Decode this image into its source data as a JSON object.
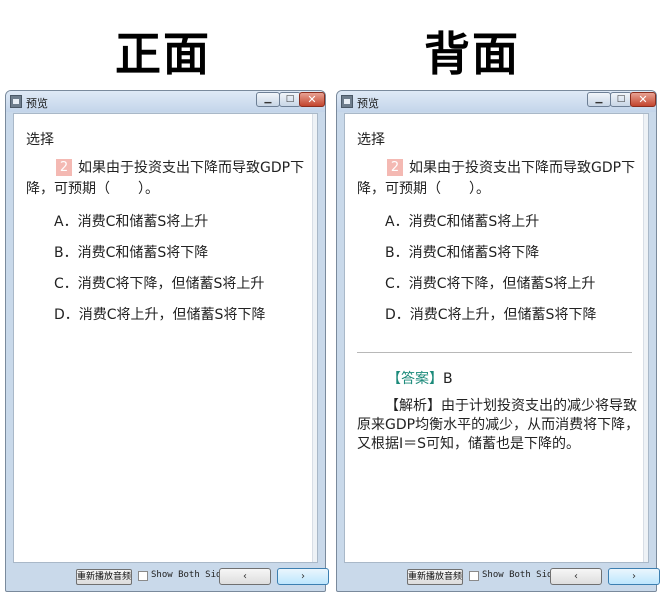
{
  "headings": {
    "front": "正面",
    "back": "背面"
  },
  "window": {
    "title": "预览",
    "close_glyph": "✕",
    "section_label": "选择",
    "question_number": "2",
    "question_text": "如果由于投资支出下降而导致GDP下降，可预期（　　）。",
    "options": [
      "A．消费C和储蓄S将上升",
      "B．消费C和储蓄S将下降",
      "C．消费C将下降，但储蓄S将上升",
      "D．消费C将上升，但储蓄S将下降"
    ],
    "replay_button": "重新播放音频",
    "show_both_sides_label": "Show Both Sides",
    "prev_glyph": "‹",
    "next_glyph": "›"
  },
  "back": {
    "answer_tag": "【答案】",
    "answer_value": "B",
    "analysis_tag": "【解析】",
    "analysis_text": "由于计划投资支出的减少将导致原来GDP均衡水平的减少，从而消费将下降，又根据I＝S可知，储蓄也是下降的。"
  }
}
